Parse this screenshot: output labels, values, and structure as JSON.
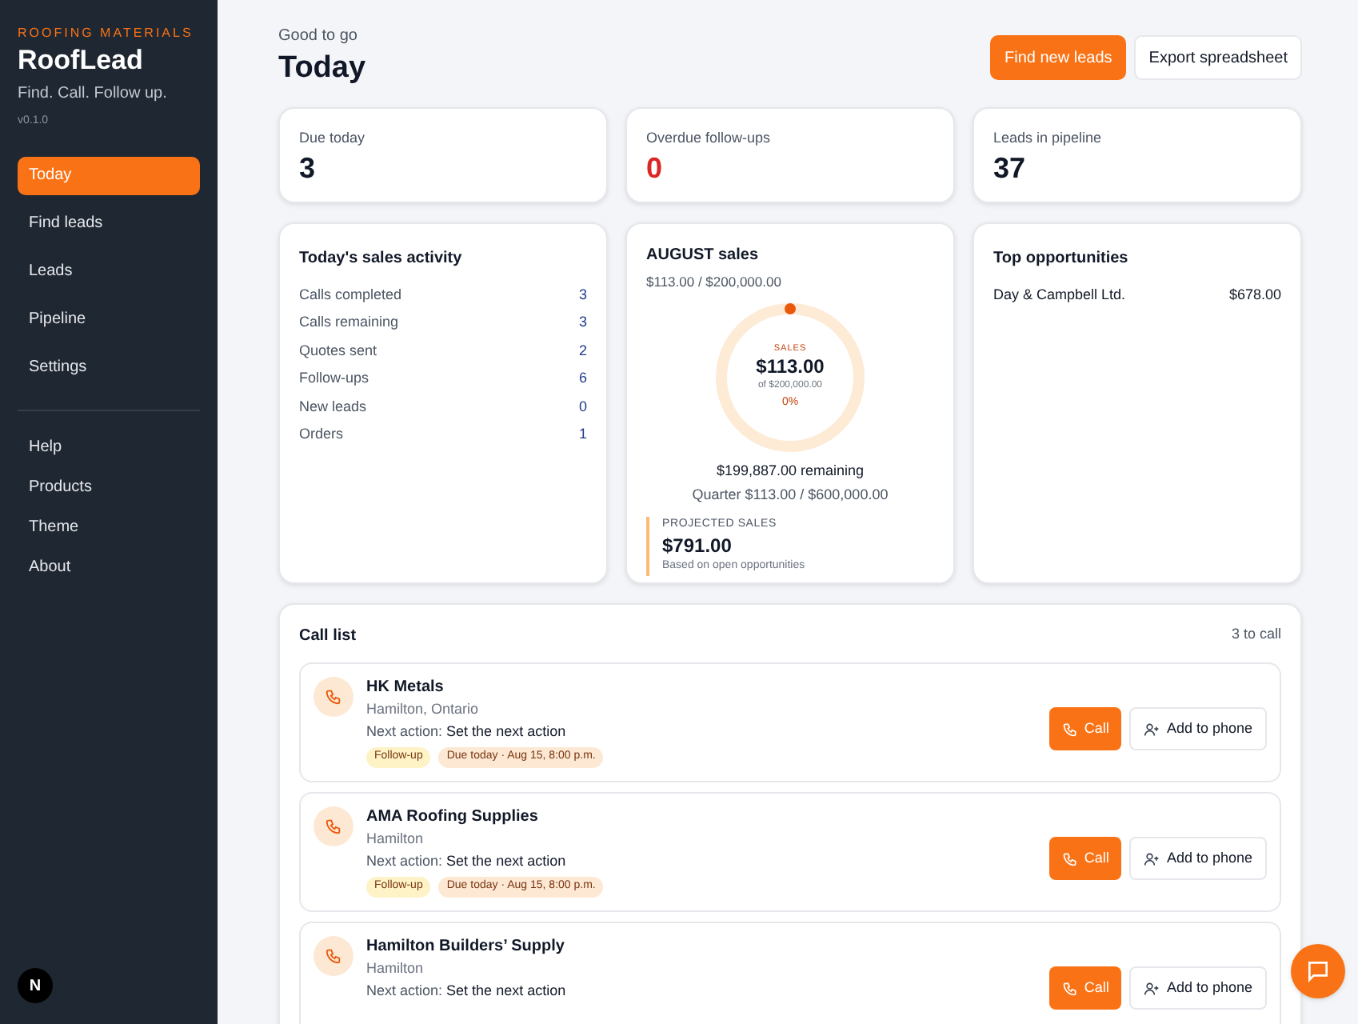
{
  "sidebar": {
    "eyebrow": "ROOFING MATERIALS",
    "brand": "RoofLead",
    "tagline": "Find. Call. Follow up.",
    "version": "v0.1.0",
    "nav": [
      {
        "label": "Today",
        "selected": true
      },
      {
        "label": "Find leads",
        "selected": false
      },
      {
        "label": "Leads",
        "selected": false
      },
      {
        "label": "Pipeline",
        "selected": false
      },
      {
        "label": "Settings",
        "selected": false
      }
    ],
    "links": [
      "Help",
      "Products",
      "Theme",
      "About"
    ],
    "badge": "N"
  },
  "header": {
    "kicker": "Good to go",
    "title": "Today",
    "actions": [
      {
        "label": "Find new leads",
        "kind": "primary"
      },
      {
        "label": "Export spreadsheet",
        "kind": "secondary"
      }
    ]
  },
  "stats": [
    {
      "label": "Due today",
      "value": "3",
      "alert": false
    },
    {
      "label": "Overdue follow-ups",
      "value": "0",
      "alert": true
    },
    {
      "label": "Leads in pipeline",
      "value": "37",
      "alert": false
    }
  ],
  "activity": {
    "title": "Today's sales activity",
    "rows": [
      {
        "label": "Calls completed",
        "value": "3"
      },
      {
        "label": "Calls remaining",
        "value": "3"
      },
      {
        "label": "Quotes sent",
        "value": "2"
      },
      {
        "label": "Follow-ups",
        "value": "6"
      },
      {
        "label": "New leads",
        "value": "0"
      },
      {
        "label": "Orders",
        "value": "1"
      }
    ]
  },
  "sales": {
    "title": "AUGUST sales",
    "summary": "$113.00 / $200,000.00",
    "ring": {
      "label": "SALES",
      "amount": "$113.00",
      "of": "of $200,000.00",
      "percent": "0%",
      "level": 0
    },
    "remaining": "$199,887.00 remaining",
    "quarter": "Quarter $113.00 / $600,000.00",
    "projected": {
      "label": "PROJECTED SALES",
      "amount": "$791.00",
      "note": "Based on open opportunities"
    }
  },
  "opportunities": {
    "title": "Top opportunities",
    "rows": [
      {
        "name": "Day & Campbell Ltd.",
        "amount": "$678.00"
      }
    ]
  },
  "call_list": {
    "title": "Call list",
    "count": "3 to call",
    "items": [
      {
        "name": "HK Metals",
        "location": "Hamilton, Ontario",
        "next_label": "Next action:",
        "next": "Set the next action",
        "tags": [
          "Follow-up",
          "Due today · Aug 15, 8:00 p.m."
        ],
        "call_label": "Call",
        "add_label": "Add to phone"
      },
      {
        "name": "AMA Roofing Supplies",
        "location": "Hamilton",
        "next_label": "Next action:",
        "next": "Set the next action",
        "tags": [
          "Follow-up",
          "Due today · Aug 15, 8:00 p.m."
        ],
        "call_label": "Call",
        "add_label": "Add to phone"
      },
      {
        "name": "Hamilton Builders’ Supply",
        "location": "Hamilton",
        "next_label": "Next action:",
        "next": "Set the next action",
        "call_label": "Call",
        "add_label": "Add to phone"
      }
    ]
  }
}
